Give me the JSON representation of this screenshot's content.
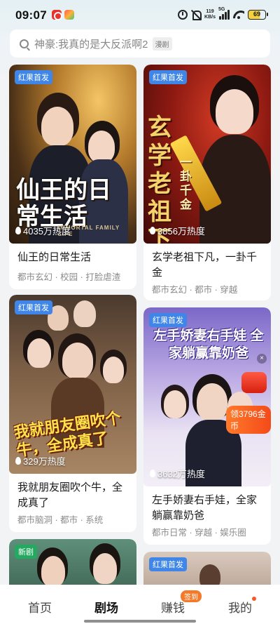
{
  "status_bar": {
    "time": "09:07",
    "net_speed_value": "119",
    "net_speed_unit": "KB/s",
    "signal_label": "5G",
    "battery": "69"
  },
  "search": {
    "text": "神豪:我真的是大反派啊2",
    "tag": "漫剧"
  },
  "cards": [
    {
      "badge": "红果首发",
      "heat": "4035万热度",
      "title": "仙王的日常生活",
      "tags": "都市玄幻 · 校园 · 打脸虐渣",
      "cover_title": "仙王的日常生活",
      "cover_subtitle": "IMMORTAL FAMILY LIFE"
    },
    {
      "badge": "红果首发",
      "heat": "3856万热度",
      "title": "玄学老祖下凡，一卦千金",
      "tags": "都市玄幻 · 都市 · 穿越",
      "cover_title": "玄学老祖下凡",
      "cover_subtitle": "一卦千金"
    },
    {
      "badge": "红果首发",
      "heat": "329万热度",
      "title": "我就朋友圈吹个牛，全成真了",
      "tags": "都市脑洞 · 都市 · 系统",
      "cover_title": "我就朋友圈吹个牛，全成真了"
    },
    {
      "badge": "红果首发",
      "heat": "3632万热度",
      "title": "左手娇妻右手娃，全家躺赢靠奶爸",
      "tags": "都市日常 · 穿越 · 娱乐圈",
      "cover_title": "左手娇妻右手娃 全家躺赢靠奶爸",
      "promo": "领3796金币"
    },
    {
      "badge": "新剧"
    },
    {
      "badge": "红果首发"
    }
  ],
  "bottom_nav": {
    "items": [
      "首页",
      "剧场",
      "赚钱",
      "我的"
    ],
    "active": "剧场",
    "earn_badge": "签到"
  },
  "colors": {
    "badge_blue": "#3f86e8",
    "badge_green": "#25a860",
    "accent_orange": "#f27a2a"
  }
}
